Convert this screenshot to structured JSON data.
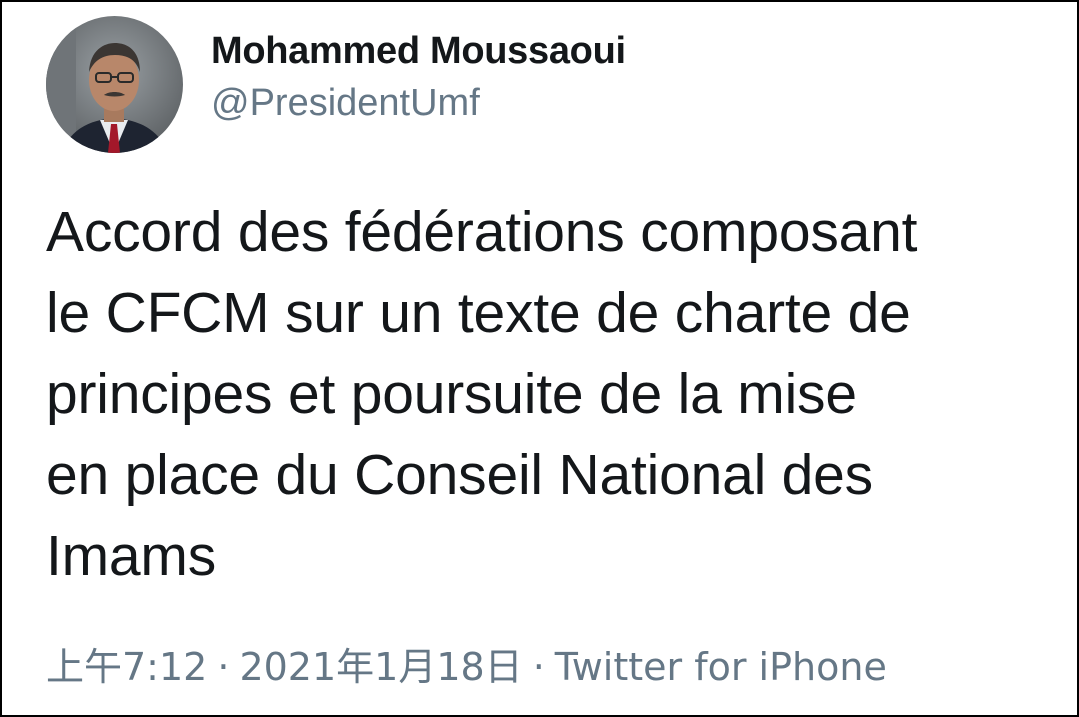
{
  "author": {
    "display_name": "Mohammed Moussaoui",
    "handle": "@PresidentUmf"
  },
  "tweet": {
    "text_lines": [
      "Accord des fédérations composant",
      "le CFCM sur un texte de charte de",
      "principes et poursuite de la mise",
      "en place du Conseil National des",
      "Imams"
    ]
  },
  "meta": {
    "time": "上午7:12",
    "separator": "·",
    "date": "2021年1月18日",
    "source": "Twitter for iPhone"
  },
  "colors": {
    "text_primary": "#14171a",
    "text_secondary": "#657786",
    "border": "#000000",
    "background": "#ffffff"
  }
}
